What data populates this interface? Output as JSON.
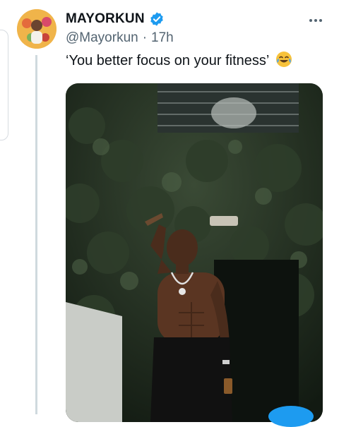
{
  "tweet": {
    "display_name": "MAYORKUN",
    "handle": "@Mayorkun",
    "separator": "·",
    "time": "17h",
    "text": "‘You better focus on your fitness’"
  },
  "icons": {
    "verified": "verified-badge-icon",
    "more": "more-options-icon",
    "emoji": "face-with-tears-of-joy-icon"
  },
  "colors": {
    "verified": "#1d9bf0",
    "text": "#0f1419",
    "secondary": "#536471",
    "thread_line": "#cfd9de"
  }
}
